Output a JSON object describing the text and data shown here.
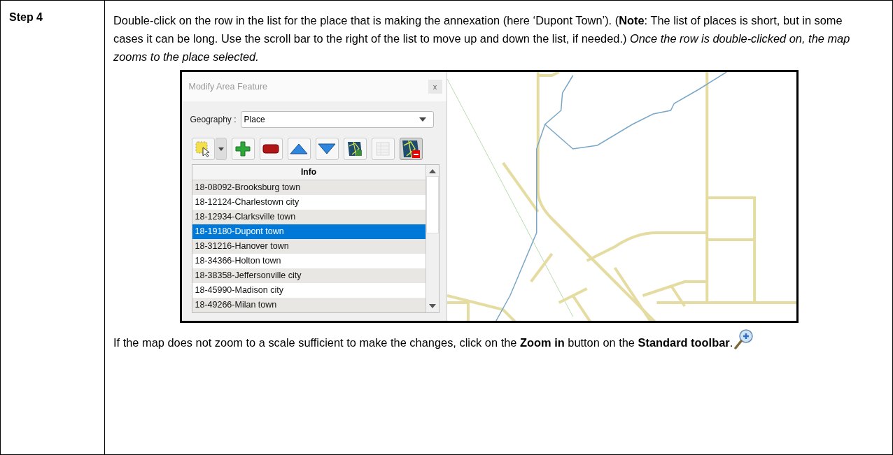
{
  "step": {
    "label": "Step 4"
  },
  "instruction": "Double-click on the row in the list for the place that is making the annexation (here ‘Dupont Town’). (**Note**:  The list of places is short, but in some cases it can be long. Use the scroll bar to the right of the list to move up and down the list, if needed.) *Once the row is double-clicked on, the map zooms to the place selected.*",
  "window": {
    "title": "Modify Area Feature",
    "close": "x"
  },
  "geography": {
    "label": "Geography :",
    "value": "Place"
  },
  "tools": [
    {
      "kind": "select",
      "disabled": false,
      "pressed": false
    },
    {
      "kind": "dropdown",
      "disabled": false,
      "pressed": false
    },
    {
      "kind": "add",
      "disabled": false,
      "pressed": false
    },
    {
      "kind": "remove",
      "disabled": false,
      "pressed": false
    },
    {
      "kind": "up",
      "disabled": false,
      "pressed": false
    },
    {
      "kind": "down",
      "disabled": false,
      "pressed": false
    },
    {
      "kind": "map-add",
      "disabled": false,
      "pressed": false
    },
    {
      "kind": "table",
      "disabled": true,
      "pressed": false
    },
    {
      "kind": "map-remove",
      "disabled": false,
      "pressed": true
    }
  ],
  "list": {
    "header": "Info",
    "rows": [
      {
        "text": "18-08092-Brooksburg town",
        "selected": false
      },
      {
        "text": "18-12124-Charlestown city",
        "selected": false
      },
      {
        "text": "18-12934-Clarksville town",
        "selected": false
      },
      {
        "text": "18-19180-Dupont town",
        "selected": true
      },
      {
        "text": "18-31216-Hanover town",
        "selected": false
      },
      {
        "text": "18-34366-Holton town",
        "selected": false
      },
      {
        "text": "18-38358-Jeffersonville city",
        "selected": false
      },
      {
        "text": "18-45990-Madison city",
        "selected": false
      },
      {
        "text": "18-49266-Milan town",
        "selected": false
      }
    ]
  },
  "footer": "If the map does not zoom to a scale sufficient to make the changes, click on the **Zoom in** button on the **Standard toolbar**."
}
